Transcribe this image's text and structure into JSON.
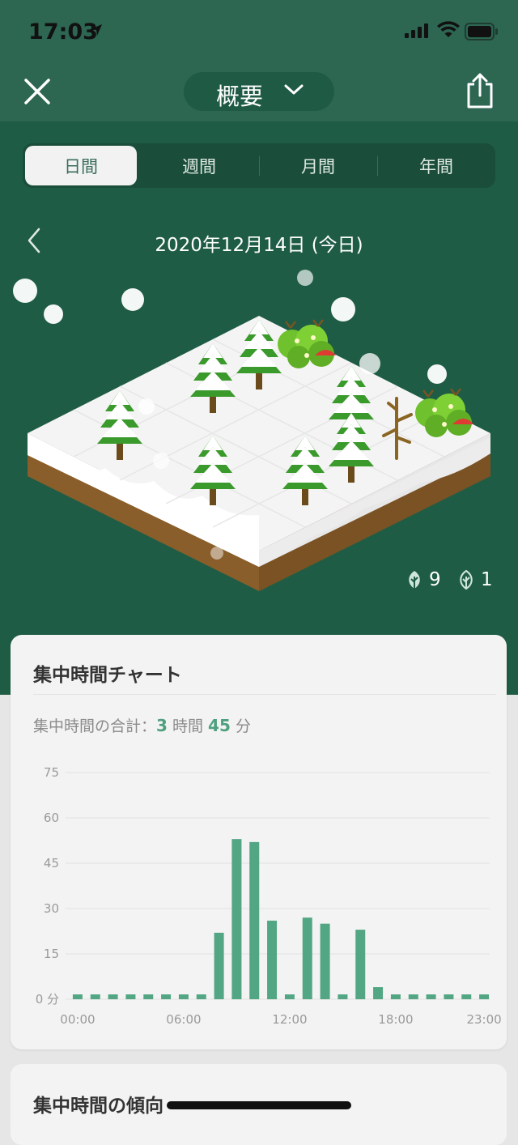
{
  "status_bar": {
    "time": "17:03"
  },
  "header": {
    "title": "概要"
  },
  "tabs": [
    {
      "label": "日間",
      "active": true
    },
    {
      "label": "週間",
      "active": false
    },
    {
      "label": "月間",
      "active": false
    },
    {
      "label": "年間",
      "active": false
    }
  ],
  "date": {
    "text": "2020年12月14日 (今日)"
  },
  "forest_counts": {
    "alive": "9",
    "withered": "1"
  },
  "chart_card": {
    "title": "集中時間チャート",
    "summary_prefix": "集中時間の合計：",
    "hours": "3",
    "hours_unit": "時間",
    "minutes": "45",
    "minutes_unit": "分"
  },
  "chart_data": {
    "type": "bar",
    "categories": [
      "00:00",
      "01:00",
      "02:00",
      "03:00",
      "04:00",
      "05:00",
      "06:00",
      "07:00",
      "08:00",
      "09:00",
      "10:00",
      "11:00",
      "12:00",
      "13:00",
      "14:00",
      "15:00",
      "16:00",
      "17:00",
      "18:00",
      "19:00",
      "20:00",
      "21:00",
      "22:00",
      "23:00"
    ],
    "values": [
      0,
      0,
      0,
      0,
      0,
      0,
      0,
      0,
      22,
      53,
      52,
      26,
      0,
      27,
      25,
      0,
      23,
      4,
      0,
      0,
      0,
      0,
      0,
      0
    ],
    "ylim": [
      0,
      75
    ],
    "yticks": [
      "0 分",
      "15",
      "30",
      "45",
      "60",
      "75"
    ],
    "xticks": [
      "00:00",
      "06:00",
      "12:00",
      "18:00",
      "23:00"
    ],
    "grid": true,
    "bar_color": "#52a683"
  },
  "trend_card": {
    "title": "集中時間の傾向"
  },
  "colors": {
    "header_bg": "#2d6651",
    "forest_bg": "#1f5c45",
    "accent": "#4ea07e"
  }
}
